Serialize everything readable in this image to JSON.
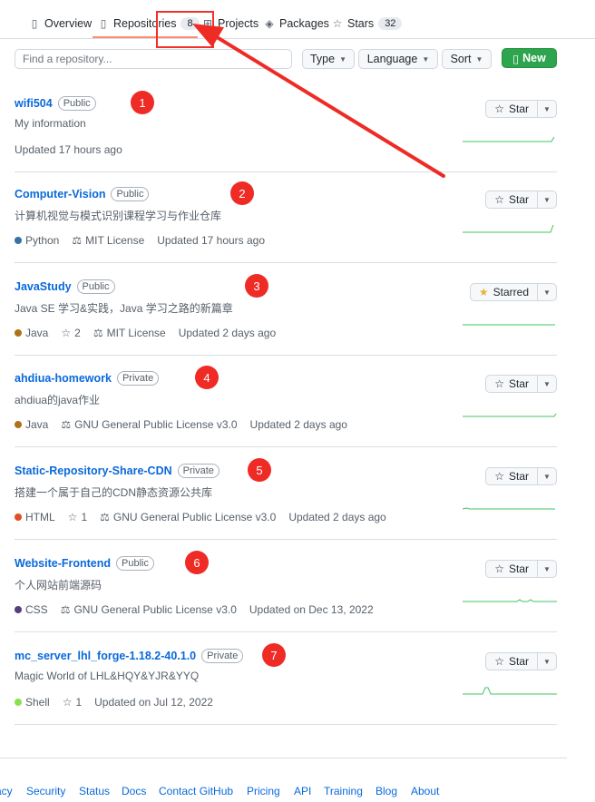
{
  "tabs": [
    {
      "label": "Overview",
      "icon": "book-icon"
    },
    {
      "label": "Repositories",
      "icon": "repo-icon",
      "count": "8"
    },
    {
      "label": "Projects",
      "icon": "project-icon"
    },
    {
      "label": "Packages",
      "icon": "package-icon"
    },
    {
      "label": "Stars",
      "icon": "star-icon",
      "count": "32"
    }
  ],
  "filters": {
    "search_placeholder": "Find a repository...",
    "type_label": "Type",
    "language_label": "Language",
    "sort_label": "Sort",
    "new_label": "New"
  },
  "repos": [
    {
      "name": "wifi504",
      "visibility": "Public",
      "description": "My information",
      "language": "",
      "lang_color": "",
      "stars": "",
      "license": "",
      "updated": "Updated 17 hours ago",
      "star_label": "Star",
      "starred": false,
      "marker": "1"
    },
    {
      "name": "Computer-Vision",
      "visibility": "Public",
      "description": "计算机视觉与模式识别课程学习与作业仓库",
      "language": "Python",
      "lang_color": "#3572A5",
      "stars": "",
      "license": "MIT License",
      "updated": "Updated 17 hours ago",
      "star_label": "Star",
      "starred": false,
      "marker": "2"
    },
    {
      "name": "JavaStudy",
      "visibility": "Public",
      "description": "Java SE 学习&实践，Java 学习之路的新篇章",
      "language": "Java",
      "lang_color": "#b07219",
      "stars": "2",
      "license": "MIT License",
      "updated": "Updated 2 days ago",
      "star_label": "Starred",
      "starred": true,
      "marker": "3"
    },
    {
      "name": "ahdiua-homework",
      "visibility": "Private",
      "description": "ahdiua的java作业",
      "language": "Java",
      "lang_color": "#b07219",
      "stars": "",
      "license": "GNU General Public License v3.0",
      "updated": "Updated 2 days ago",
      "star_label": "Star",
      "starred": false,
      "marker": "4"
    },
    {
      "name": "Static-Repository-Share-CDN",
      "visibility": "Private",
      "description": "搭建一个属于自己的CDN静态资源公共库",
      "language": "HTML",
      "lang_color": "#e34c26",
      "stars": "1",
      "license": "GNU General Public License v3.0",
      "updated": "Updated 2 days ago",
      "star_label": "Star",
      "starred": false,
      "marker": "5"
    },
    {
      "name": "Website-Frontend",
      "visibility": "Public",
      "description": "个人网站前端源码",
      "language": "CSS",
      "lang_color": "#563d7c",
      "stars": "",
      "license": "GNU General Public License v3.0",
      "updated": "Updated on Dec 13, 2022",
      "star_label": "Star",
      "starred": false,
      "marker": "6"
    },
    {
      "name": "mc_server_lhl_forge-1.18.2-40.1.0",
      "visibility": "Private",
      "description": "Magic World of LHL&HQY&YJR&YYQ",
      "language": "Shell",
      "lang_color": "#89e051",
      "stars": "1",
      "license": "",
      "updated": "Updated on Jul 12, 2022",
      "star_label": "Star",
      "starred": false,
      "marker": "7"
    }
  ],
  "footer": [
    "acy",
    "Security",
    "Status",
    "Docs",
    "Contact GitHub",
    "Pricing",
    "API",
    "Training",
    "Blog",
    "About"
  ],
  "colors": {
    "accent": "#0969da",
    "new_button": "#2da44e",
    "annotation": "#ee2b25",
    "starred_icon": "#e3b341",
    "sparkline": "#40c463"
  }
}
